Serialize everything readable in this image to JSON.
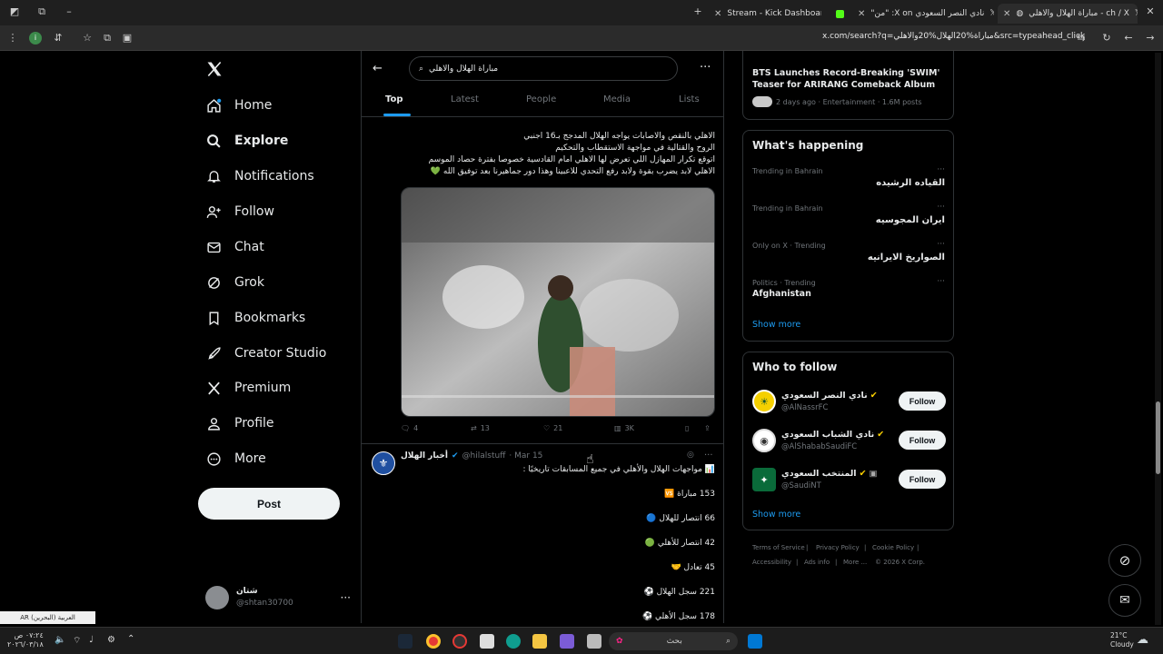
{
  "browser": {
    "tabs": [
      {
        "label": "Stream - Kick Dashboard"
      },
      {
        "label": "\"من\" :X on نادي النصر السعودي"
      },
      {
        "label": "مباراة الهلال والاهلي - ch / X"
      }
    ],
    "url": "x.com/search?q=مباراة%20الهلال%20والاهلي&src=typeahead_click"
  },
  "nav": {
    "items": [
      {
        "label": "Home"
      },
      {
        "label": "Explore"
      },
      {
        "label": "Notifications"
      },
      {
        "label": "Follow"
      },
      {
        "label": "Chat"
      },
      {
        "label": "Grok"
      },
      {
        "label": "Bookmarks"
      },
      {
        "label": "Creator Studio"
      },
      {
        "label": "Premium"
      },
      {
        "label": "Profile"
      },
      {
        "label": "More"
      }
    ],
    "post_label": "Post",
    "account": {
      "name": "شتان",
      "handle": "@shtan30700"
    }
  },
  "search": {
    "query": "مباراة الهلال والاهلي",
    "tabs": [
      "Top",
      "Latest",
      "People",
      "Media",
      "Lists"
    ]
  },
  "post1": {
    "lines": [
      "الاهلي بالنقص والاصابات يواجه الهلال المدجج بـ16 اجنبي",
      "الروح والقتالية في مواجهة الاستقطاب والتحكيم",
      "اتوقع تكرار المهازل اللي تعرض لها الاهلي امام القادسية خصوصا بفترة حصاد الموسم",
      "الاهلي لابد يضرب بقوة ولابد رفع التحدي للاعبينا وهذا دور جماهيرنا بعد توفيق الله 💚"
    ],
    "replies": "4",
    "reposts": "13",
    "likes": "21",
    "views": "3K"
  },
  "post2": {
    "author": "أخبار الهلال",
    "handle": "@hilalstuff",
    "date": "· Mar 15",
    "headline": "📊 مواجهات الهلال والأهلي في جميع المسابقات تاريخيًا :",
    "stats": [
      "153 مباراة 🆚",
      "66 انتصار للهلال 🔵",
      "42 انتصار للأهلي 🟢",
      "45 تعادل 🤝",
      "221 سجل الهلال ⚽",
      "178 سجل الأهلي ⚽"
    ]
  },
  "trend_top": {
    "title": "BTS Launches Record-Breaking 'SWIM' Teaser for ARIRANG Comeback Album",
    "meta": "2 days ago · Entertainment · 1.6M posts"
  },
  "whats_happening": {
    "title": "What's happening",
    "items": [
      {
        "context": "Trending in Bahrain",
        "name": "القياده الرشيده"
      },
      {
        "context": "Trending in Bahrain",
        "name": "ايران المجوسيه"
      },
      {
        "context": "Only on X · Trending",
        "name": "الصواريخ الايرانيه"
      },
      {
        "context": "Politics · Trending",
        "name": "Afghanistan"
      }
    ],
    "show_more": "Show more"
  },
  "who_to_follow": {
    "title": "Who to follow",
    "accounts": [
      {
        "name": "نادي النصر السعودي",
        "handle": "@AlNassrFC",
        "button": "Follow"
      },
      {
        "name": "نادي الشباب السعودي",
        "handle": "@AlShababSaudiFC",
        "button": "Follow"
      },
      {
        "name": "المنتخب السعودي",
        "handle": "@SaudiNT",
        "button": "Follow"
      }
    ],
    "show_more": "Show more"
  },
  "footer": {
    "links": [
      "Terms of Service",
      "Privacy Policy",
      "Cookie Policy",
      "Accessibility",
      "Ads info",
      "More ...",
      "© 2026 X Corp."
    ]
  },
  "taskbar": {
    "lang": "AR العربية (البحرين)",
    "search": "بحث",
    "weather_temp": "21°C",
    "weather_desc": "Cloudy",
    "time": "٠٧:٢٤ ص",
    "date": "٢٠٢٦/٠٣/١٨"
  },
  "colors": {
    "bg": "#000000",
    "accent": "#1d9bf0",
    "muted": "#71767b",
    "border": "#2f3336",
    "verified": "#ffd400"
  }
}
